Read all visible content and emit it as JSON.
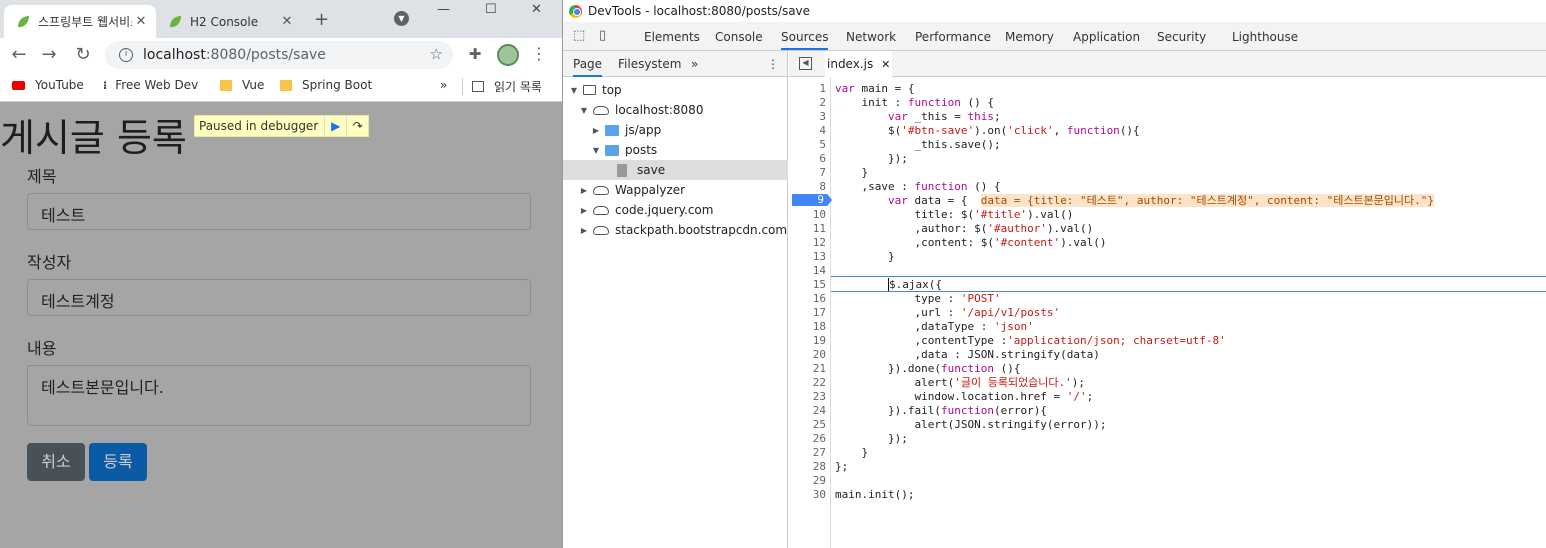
{
  "browser": {
    "tabs": [
      {
        "title": "스프링부트 웹서비스",
        "close": "✕"
      },
      {
        "title": "H2 Console",
        "close": "✕"
      }
    ],
    "new_tab": "+",
    "window_controls": [
      "—",
      "☐",
      "✕"
    ],
    "url_host": "localhost",
    "url_path": ":8080/posts/save",
    "bookmarks": [
      {
        "label": "YouTube",
        "icon": "youtube-icon"
      },
      {
        "label": "Free Web Dev",
        "icon": "dots-icon"
      },
      {
        "label": "Vue",
        "icon": "folder-icon"
      },
      {
        "label": "Spring Boot",
        "icon": "folder-icon"
      }
    ],
    "reading_list": "읽기 목록",
    "more_bookmarks": "»"
  },
  "page": {
    "heading": "게시글 등록",
    "debugger": "Paused in debugger",
    "fields": [
      {
        "label": "제목",
        "value": "테스트"
      },
      {
        "label": "작성자",
        "value": "테스트계정"
      },
      {
        "label": "내용",
        "value": "테스트본문입니다."
      }
    ],
    "cancel_label": "취소",
    "submit_label": "등록",
    "colors": {
      "overlay": "#a5a5a5",
      "cancel": "#495057",
      "submit": "#0b5aa6"
    }
  },
  "devtools": {
    "title": "DevTools - localhost:8080/posts/save",
    "tabs": [
      "Elements",
      "Console",
      "Sources",
      "Network",
      "Performance",
      "Memory",
      "Application",
      "Security",
      "Lighthouse"
    ],
    "active_tab": "Sources",
    "nav_tabs": [
      "Page",
      "Filesystem"
    ],
    "nav_more": "»",
    "tree": [
      "top",
      "localhost:8080",
      "js/app",
      "posts",
      "save",
      "Wappalyzer",
      "code.jquery.com",
      "stackpath.bootstrapcdn.com"
    ],
    "open_file": "index.js",
    "close_file": "✕",
    "breakpoint_line": "9",
    "current_line": "15",
    "inline_value": "data = {title: \"테스트\", author: \"테스트계정\", content: \"테스트본문입니다.\"}",
    "code": [
      "var main = {",
      "    init : function () {",
      "        var _this = this;",
      "        $('#btn-save').on('click', function(){",
      "            _this.save();",
      "        });",
      "    }",
      "    ,save : function () {",
      "        var data = {",
      "            title: $('#title').val()",
      "            ,author: $('#author').val()",
      "            ,content: $('#content').val()",
      "        }",
      "",
      "        $.ajax({",
      "            type : 'POST'",
      "            ,url : '/api/v1/posts'",
      "            ,dataType : 'json'",
      "            ,contentType :'application/json; charset=utf-8'",
      "            ,data : JSON.stringify(data)",
      "        }).done(function (){",
      "            alert('글이 등록되었습니다.');",
      "            window.location.href = '/';",
      "        }).fail(function(error){",
      "            alert(JSON.stringify(error));",
      "        });",
      "    }",
      "};",
      "",
      "main.init();"
    ]
  }
}
